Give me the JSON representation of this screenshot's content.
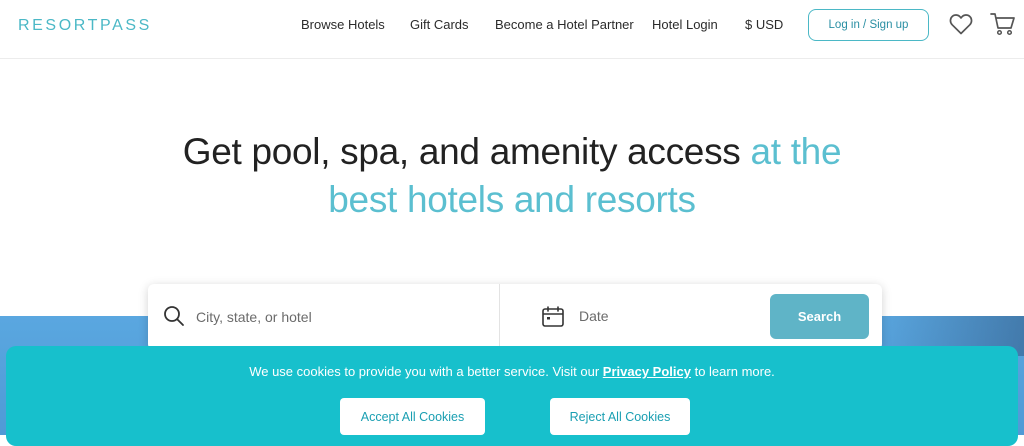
{
  "header": {
    "logo": "RESORTPASS",
    "nav": {
      "browse_hotels": "Browse Hotels",
      "gift_cards": "Gift Cards",
      "become_partner": "Become a Hotel Partner",
      "hotel_login": "Hotel Login",
      "currency": "$ USD"
    },
    "login_label": "Log in / Sign up",
    "icons": [
      "heart-icon",
      "cart-icon"
    ]
  },
  "hero": {
    "title_part1": "Get pool, spa, and amenity access",
    "title_accent_1": "at the",
    "title_accent_2": "best hotels and resorts"
  },
  "search": {
    "location_placeholder": "City, state, or hotel",
    "date_label": "Date",
    "button_label": "Search",
    "icons": [
      "search-icon",
      "calendar-icon"
    ]
  },
  "cookie_banner": {
    "text_before": "We use cookies to provide you with a better service. Visit our",
    "link_text": "Privacy Policy",
    "text_after": "to learn more.",
    "accept_label": "Accept All Cookies",
    "reject_label": "Reject All Cookies"
  },
  "colors": {
    "brand": "#4bb8c6",
    "accent_text": "#5bbfd0",
    "search_button": "#5fb4c7",
    "cookie_banner": "#17c0cc"
  }
}
